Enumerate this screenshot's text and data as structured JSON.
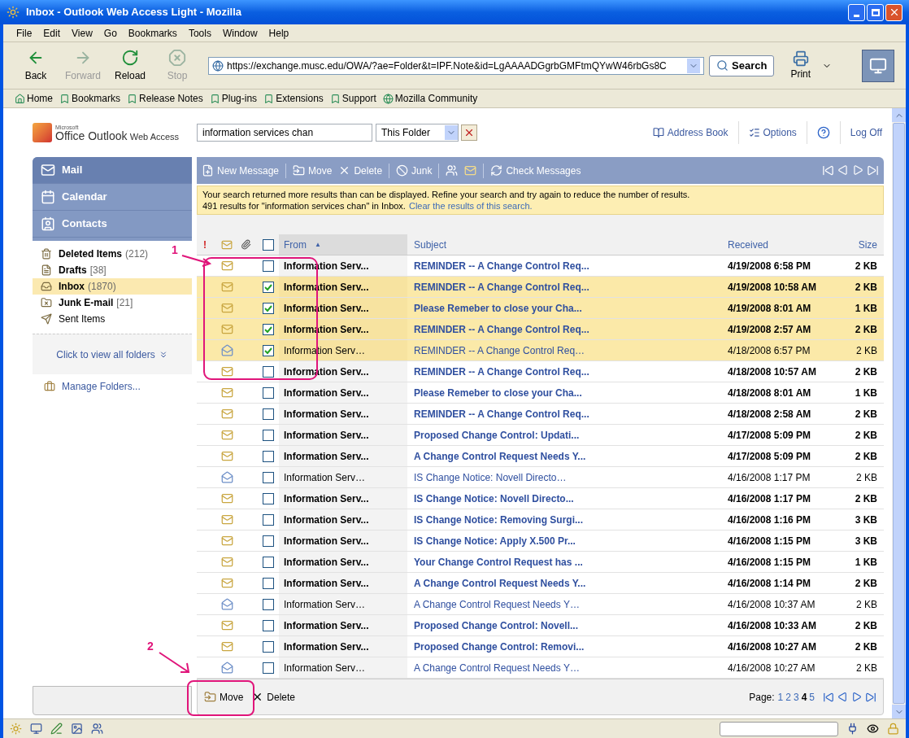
{
  "browser": {
    "title": "Inbox - Outlook Web Access Light - Mozilla",
    "menu": [
      "File",
      "Edit",
      "View",
      "Go",
      "Bookmarks",
      "Tools",
      "Window",
      "Help"
    ],
    "nav_buttons": [
      {
        "label": "Back",
        "disabled": false
      },
      {
        "label": "Forward",
        "disabled": true
      },
      {
        "label": "Reload",
        "disabled": false
      },
      {
        "label": "Stop",
        "disabled": true
      }
    ],
    "url": "https://exchange.musc.edu/OWA/?ae=Folder&t=IPF.Note&id=LgAAAADGgrbGMFtmQYwW46rbGs8C",
    "search_button": "Search",
    "print_button": "Print",
    "bookmarks": [
      "Home",
      "Bookmarks",
      "Release Notes",
      "Plug-ins",
      "Extensions",
      "Support",
      "Mozilla Community"
    ]
  },
  "owa": {
    "logo": {
      "maker": "Microsoft",
      "product": "Office Outlook",
      "suffix": "Web Access"
    },
    "search": {
      "value": "information services chan",
      "scope": "This Folder"
    },
    "header_links": [
      "Address Book",
      "Options",
      "Log Off"
    ],
    "nav": [
      {
        "label": "Mail",
        "selected": true
      },
      {
        "label": "Calendar",
        "selected": false
      },
      {
        "label": "Contacts",
        "selected": false
      }
    ],
    "folders": [
      {
        "name": "Deleted Items",
        "count": "(212)",
        "unread": true,
        "selected": false
      },
      {
        "name": "Drafts",
        "count": "[38]",
        "unread": true,
        "selected": false
      },
      {
        "name": "Inbox",
        "count": "(1870)",
        "unread": true,
        "selected": true
      },
      {
        "name": "Junk E-mail",
        "count": "[21]",
        "unread": true,
        "selected": false
      },
      {
        "name": "Sent Items",
        "unread": false,
        "selected": false
      }
    ],
    "view_all": "Click to view all folders",
    "manage": "Manage Folders...",
    "toolbar": [
      "New Message",
      "Move",
      "Delete",
      "Junk",
      "Check Messages"
    ],
    "info": {
      "line1": "Your search returned more results than can be displayed. Refine your search and try again to reduce the number of results.",
      "line2": "491 results for \"information services chan\" in Inbox.",
      "link": "Clear the results of this search."
    },
    "columns": {
      "importance": "!",
      "from": "From",
      "sort_mark": "▲",
      "subject": "Subject",
      "received": "Received",
      "size": "Size",
      "select_all": false
    },
    "rows": [
      {
        "read": false,
        "checked": false,
        "from": "Information Serv...",
        "subject": "REMINDER -- A Change Control Req...",
        "received": "4/19/2008 6:58 PM",
        "size": "2 KB"
      },
      {
        "read": false,
        "checked": true,
        "from": "Information Serv...",
        "subject": "REMINDER -- A Change Control Req...",
        "received": "4/19/2008 10:58 AM",
        "size": "2 KB"
      },
      {
        "read": false,
        "checked": true,
        "from": "Information Serv...",
        "subject": "Please Remeber to close your Cha...",
        "received": "4/19/2008 8:01 AM",
        "size": "1 KB"
      },
      {
        "read": false,
        "checked": true,
        "from": "Information Serv...",
        "subject": "REMINDER -- A Change Control Req...",
        "received": "4/19/2008 2:57 AM",
        "size": "2 KB"
      },
      {
        "read": true,
        "checked": true,
        "from": "Information Serv…",
        "subject": "REMINDER -- A Change Control Req…",
        "received": "4/18/2008 6:57 PM",
        "size": "2 KB"
      },
      {
        "read": false,
        "checked": false,
        "from": "Information Serv...",
        "subject": "REMINDER -- A Change Control Req...",
        "received": "4/18/2008 10:57 AM",
        "size": "2 KB"
      },
      {
        "read": false,
        "checked": false,
        "from": "Information Serv...",
        "subject": "Please Remeber to close your Cha...",
        "received": "4/18/2008 8:01 AM",
        "size": "1 KB"
      },
      {
        "read": false,
        "checked": false,
        "from": "Information Serv...",
        "subject": "REMINDER -- A Change Control Req...",
        "received": "4/18/2008 2:58 AM",
        "size": "2 KB"
      },
      {
        "read": false,
        "checked": false,
        "from": "Information Serv...",
        "subject": "Proposed Change Control: Updati...",
        "received": "4/17/2008 5:09 PM",
        "size": "2 KB"
      },
      {
        "read": false,
        "checked": false,
        "from": "Information Serv...",
        "subject": "A Change Control Request Needs Y...",
        "received": "4/17/2008 5:09 PM",
        "size": "2 KB"
      },
      {
        "read": true,
        "checked": false,
        "from": "Information Serv…",
        "subject": "IS Change Notice: Novell Directo…",
        "received": "4/16/2008 1:17 PM",
        "size": "2 KB"
      },
      {
        "read": false,
        "checked": false,
        "from": "Information Serv...",
        "subject": "IS Change Notice: Novell Directo...",
        "received": "4/16/2008 1:17 PM",
        "size": "2 KB"
      },
      {
        "read": false,
        "checked": false,
        "from": "Information Serv...",
        "subject": "IS Change Notice: Removing Surgi...",
        "received": "4/16/2008 1:16 PM",
        "size": "3 KB"
      },
      {
        "read": false,
        "checked": false,
        "from": "Information Serv...",
        "subject": "IS Change Notice: Apply X.500 Pr...",
        "received": "4/16/2008 1:15 PM",
        "size": "3 KB"
      },
      {
        "read": false,
        "checked": false,
        "from": "Information Serv...",
        "subject": "Your Change Control Request has ...",
        "received": "4/16/2008 1:15 PM",
        "size": "1 KB"
      },
      {
        "read": false,
        "checked": false,
        "from": "Information Serv...",
        "subject": "A Change Control Request Needs Y...",
        "received": "4/16/2008 1:14 PM",
        "size": "2 KB"
      },
      {
        "read": true,
        "checked": false,
        "from": "Information Serv…",
        "subject": "A Change Control Request Needs Y…",
        "received": "4/16/2008 10:37 AM",
        "size": "2 KB"
      },
      {
        "read": false,
        "checked": false,
        "from": "Information Serv...",
        "subject": "Proposed Change Control: Novell...",
        "received": "4/16/2008 10:33 AM",
        "size": "2 KB"
      },
      {
        "read": false,
        "checked": false,
        "from": "Information Serv...",
        "subject": "Proposed Change Control: Removi...",
        "received": "4/16/2008 10:27 AM",
        "size": "2 KB"
      },
      {
        "read": true,
        "checked": false,
        "from": "Information Serv…",
        "subject": "A Change Control Request Needs Y…",
        "received": "4/16/2008 10:27 AM",
        "size": "2 KB"
      }
    ],
    "bottom_toolbar": [
      "Move",
      "Delete"
    ],
    "pager": {
      "label": "Page:",
      "pages": [
        {
          "label": "1",
          "selected": false
        },
        {
          "label": "2",
          "selected": false
        },
        {
          "label": "3",
          "selected": false
        },
        {
          "label": "4",
          "selected": true
        },
        {
          "label": "5",
          "selected": false
        }
      ]
    }
  },
  "annotations": [
    {
      "label": "1"
    },
    {
      "label": "2"
    }
  ]
}
